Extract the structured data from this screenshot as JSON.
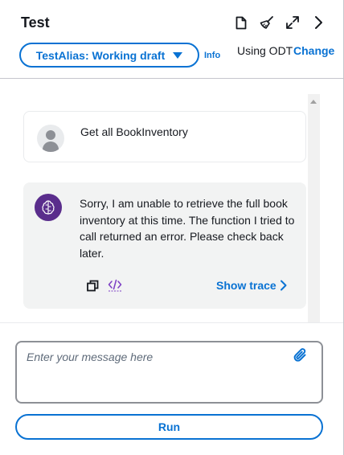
{
  "header": {
    "title": "Test",
    "icons": [
      "document-icon",
      "broom-icon",
      "expand-icon",
      "chevron-right-icon"
    ],
    "alias_label": "TestAlias: Working draft",
    "info_label": "Info",
    "odt_text": "Using ODT",
    "odt_change": "Change"
  },
  "chat": {
    "messages": [
      {
        "role": "user",
        "text": "Get all BookInventory"
      },
      {
        "role": "agent",
        "text": "Sorry, I am unable to retrieve the full book inventory at this time. The function I tried to call returned an error. Please check back later."
      }
    ],
    "show_trace_label": "Show trace"
  },
  "footer": {
    "input_placeholder": "Enter your message here",
    "input_value": "",
    "run_label": "Run"
  },
  "colors": {
    "accent": "#0972d3",
    "bot_avatar": "#5a2d8c",
    "bot_bubble": "#f2f3f3",
    "border": "#c6c6cd"
  }
}
